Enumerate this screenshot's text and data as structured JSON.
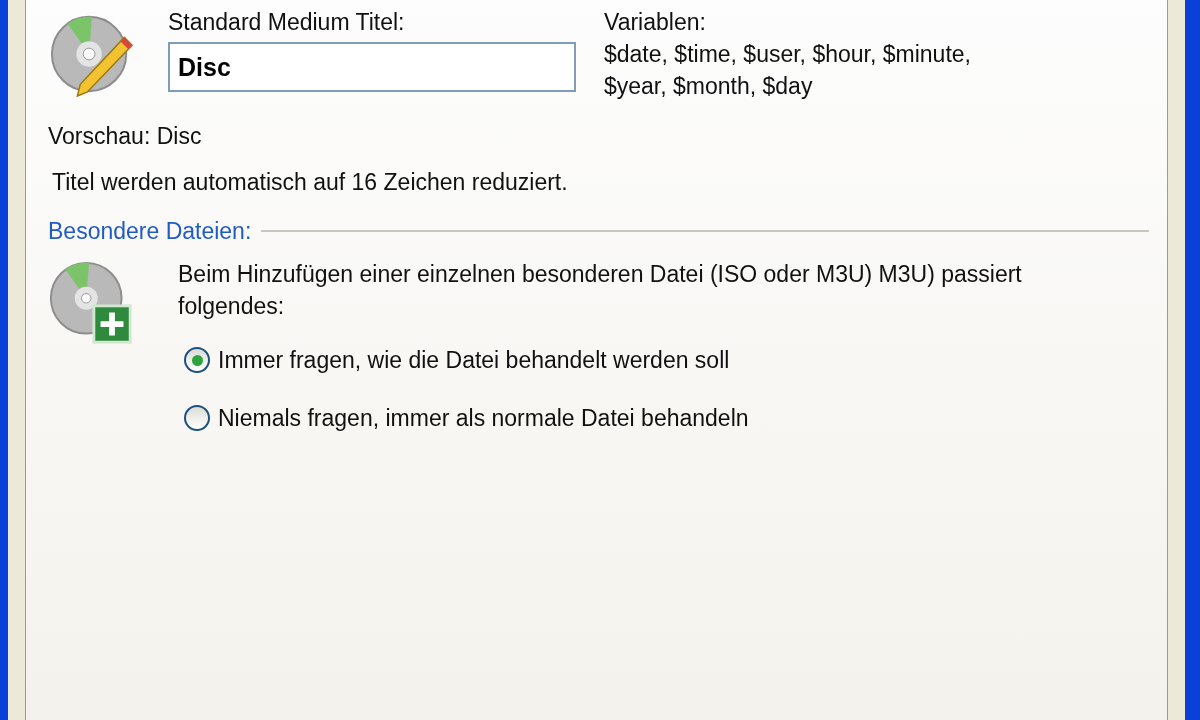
{
  "title_section": {
    "label": "Standard Medium Titel:",
    "value": "Disc",
    "variables_label": "Variablen:",
    "variables_lines": [
      "$date, $time, $user, $hour, $minute,",
      "$year, $month, $day"
    ]
  },
  "preview": "Vorschau: Disc",
  "note": "Titel werden automatisch auf 16 Zeichen reduziert.",
  "special_files": {
    "heading": "Besondere Dateien:",
    "description": "Beim Hinzufügen einer einzelnen besonderen Datei (ISO oder M3U) M3U) passiert folgendes:",
    "options": [
      {
        "label": "Immer fragen, wie die Datei behandelt werden soll",
        "selected": true
      },
      {
        "label": "Niemals fragen, immer als normale Datei behandeln",
        "selected": false
      }
    ]
  }
}
